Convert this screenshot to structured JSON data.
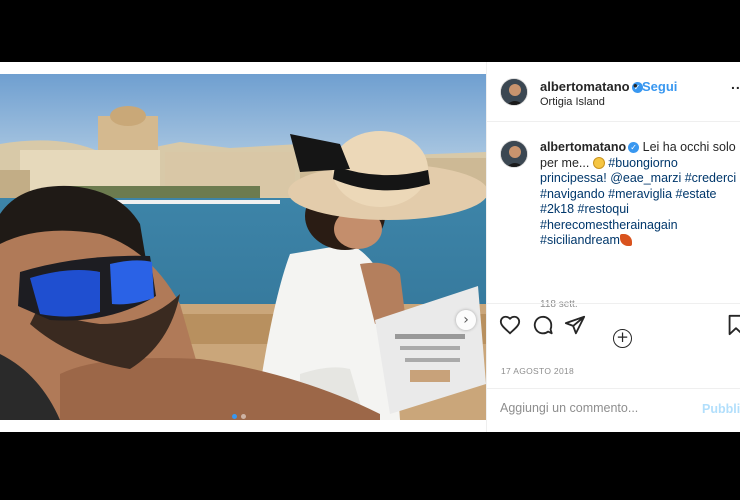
{
  "post": {
    "username": "albertomatano",
    "location": "Ortigia Island",
    "follow_label": "Segui",
    "separator": "•",
    "more_label": "...",
    "caption": {
      "text": "Lei ha occhi solo per me...",
      "tags_line_1": "#buongiorno principessa!",
      "mention": "@eae_marzi",
      "tags": "#crederci #navigando #meraviglia #estate #2k18 #restoqui #herecomestherainagain #siciliandream"
    },
    "time_ago": "118 sett.",
    "add_label": "+",
    "date": "17 AGOSTO 2018",
    "comment_placeholder": "Aggiungi un commento...",
    "publish_label": "Pubblica",
    "carousel": {
      "slide_count": 2,
      "active_slide": 1,
      "next_label": "›"
    }
  },
  "icons": {
    "like": "heart-icon",
    "comment": "comment-icon",
    "share": "share-icon",
    "save": "bookmark-icon",
    "verified": "verified-badge-icon"
  },
  "colors": {
    "accent": "#3897f0",
    "muted": "#8e8e8e",
    "text": "#262626",
    "publish_disabled": "#b2dffc"
  }
}
